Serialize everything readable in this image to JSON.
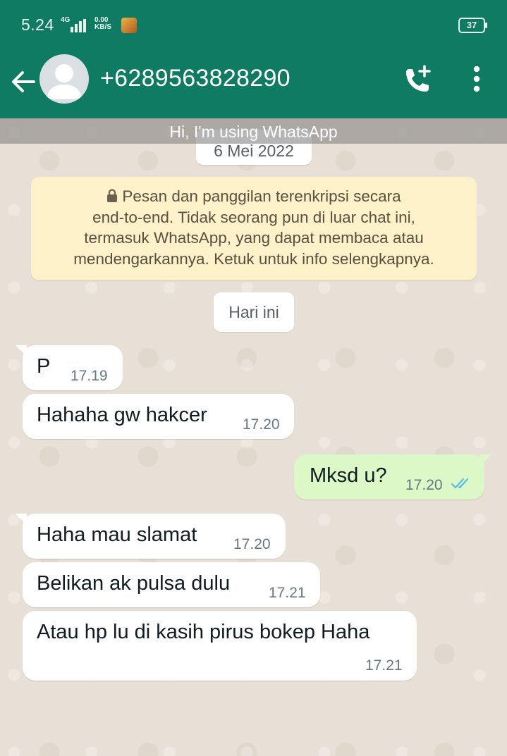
{
  "status_bar": {
    "time": "5.24",
    "network": "4G",
    "speed_value": "0.00",
    "speed_unit": "KB/S",
    "battery": "37"
  },
  "header": {
    "contact": "+6289563828290",
    "status_banner": "Hi, I'm using WhatsApp",
    "icons": {
      "back": "back-arrow-icon",
      "call": "add-call-icon",
      "menu": "more-vert-icon"
    }
  },
  "chat": {
    "date_chip": "6 Mei 2022",
    "encryption_lines": [
      "Pesan dan panggilan terenkripsi secara",
      "end-to-end. Tidak seorang pun di luar chat ini,",
      "termasuk WhatsApp, yang dapat membaca atau",
      "mendengarkannya. Ketuk untuk info selengkapnya."
    ],
    "today_chip": "Hari ini",
    "messages": [
      {
        "direction": "in",
        "text": "P",
        "time": "17.19"
      },
      {
        "direction": "in",
        "text": "Hahaha gw hakcer",
        "time": "17.20"
      },
      {
        "direction": "out",
        "text": "Mksd u?",
        "time": "17.20",
        "status": "read"
      },
      {
        "direction": "in",
        "text": "Haha mau slamat",
        "time": "17.20"
      },
      {
        "direction": "in",
        "text": "Belikan ak pulsa dulu",
        "time": "17.21"
      },
      {
        "direction": "in",
        "text": "Atau hp lu di kasih pirus bokep Haha",
        "time": "17.21"
      }
    ]
  },
  "colors": {
    "header": "#0f7b63",
    "outgoing_bubble": "#dcf8c6",
    "incoming_bubble": "#ffffff",
    "encryption_notice": "#fdf1c9",
    "read_ticks": "#53bdeb"
  }
}
